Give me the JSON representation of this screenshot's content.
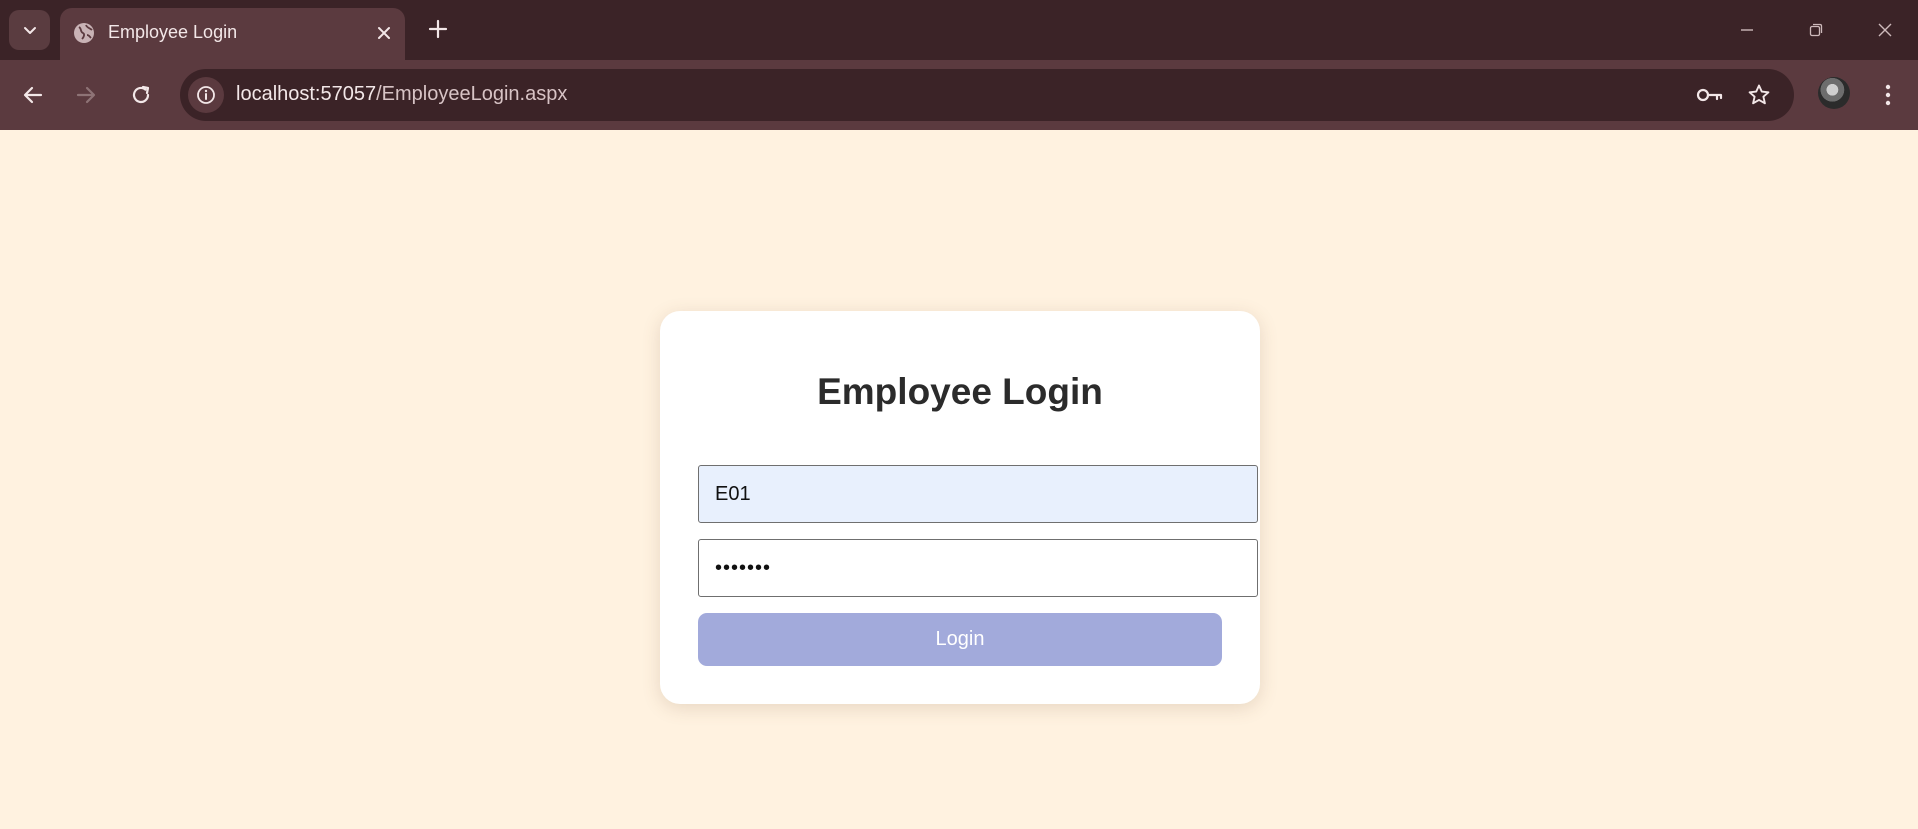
{
  "browser": {
    "tab": {
      "title": "Employee Login"
    },
    "address_bar": {
      "host": "localhost:57057",
      "path": "/EmployeeLogin.aspx"
    }
  },
  "login": {
    "title": "Employee Login",
    "employee_id_value": "E01",
    "password_value": "1234567",
    "button_label": "Login"
  },
  "colors": {
    "page_background": "#fff2e0",
    "button": "#a2aadb",
    "autofill_field": "#e8f0fd",
    "chrome_dark": "#3b2327",
    "chrome_light": "#5b3a3f"
  }
}
